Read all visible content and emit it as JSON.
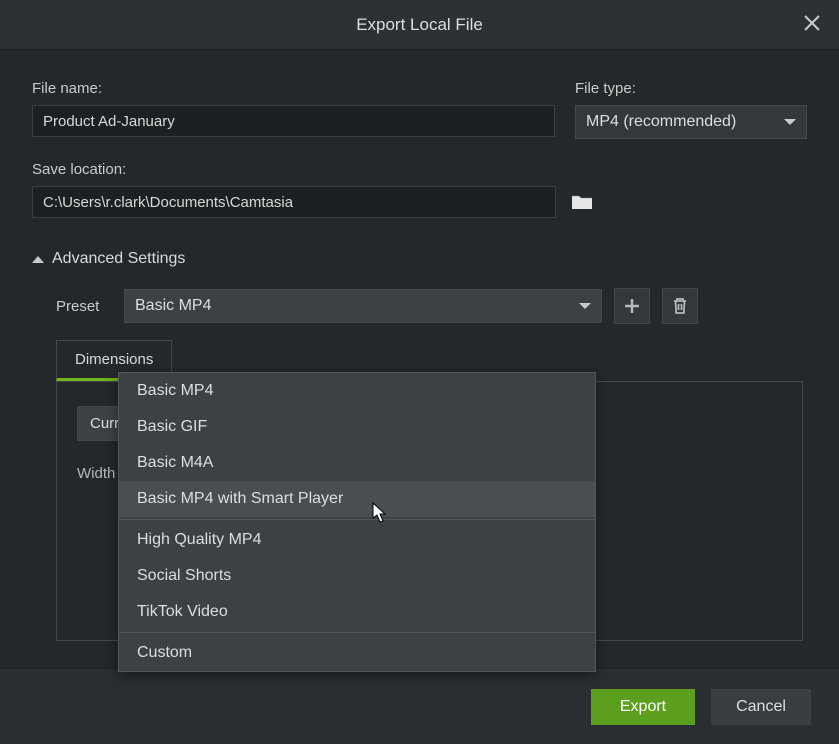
{
  "dialog": {
    "title": "Export Local File"
  },
  "file_name": {
    "label": "File name:",
    "value": "Product Ad-January"
  },
  "file_type": {
    "label": "File type:",
    "value": "MP4 (recommended)"
  },
  "save_location": {
    "label": "Save location:",
    "value": "C:\\Users\\r.clark\\Documents\\Camtasia"
  },
  "advanced": {
    "title": "Advanced Settings",
    "preset_label": "Preset",
    "preset_value": "Basic MP4",
    "preset_options": {
      "0": "Basic MP4",
      "1": "Basic GIF",
      "2": "Basic M4A",
      "3": "Basic MP4 with Smart Player",
      "4": "High Quality MP4",
      "5": "Social Shorts",
      "6": "TikTok Video",
      "7": "Custom"
    }
  },
  "tabs": {
    "dimensions": "Dimensions"
  },
  "dimensions_panel": {
    "current_label_prefix": "Curr",
    "width_label": "Width"
  },
  "footer": {
    "export": "Export",
    "cancel": "Cancel"
  }
}
